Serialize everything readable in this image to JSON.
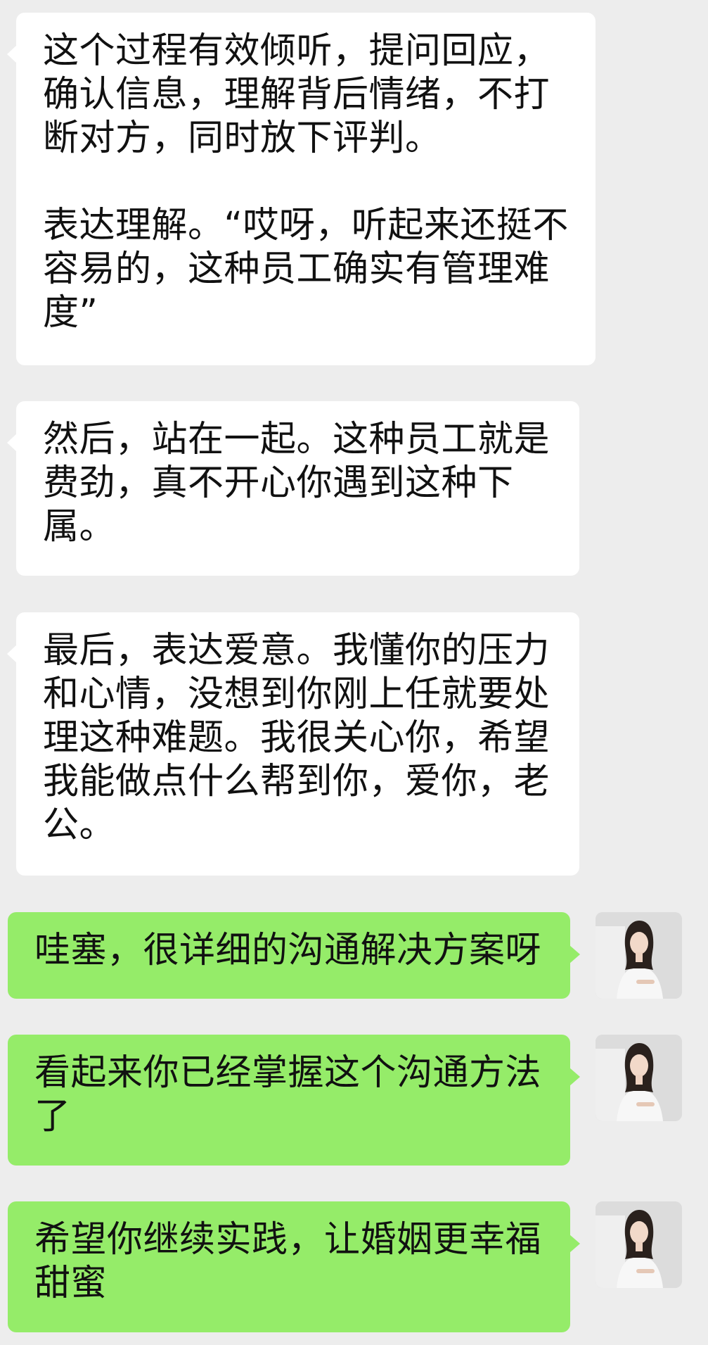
{
  "conversation": {
    "incoming": [
      {
        "text": "这个过程有效倾听，提问回应，\n确认信息，理解背后情绪，不打\n断对方，同时放下评判。\n\n表达理解。“哎呀，听起来还挺不\n容易的，这种员工确实有管理难\n度”"
      },
      {
        "text": "然后，站在一起。这种员工就是\n费劲，真不开心你遇到这种下\n属。"
      },
      {
        "text": "最后，表达爱意。我懂你的压力\n和心情，没想到你刚上任就要处\n理这种难题。我很关心你，希望\n我能做点什么帮到你，爱你，老\n公。"
      }
    ],
    "outgoing": [
      {
        "text": "哇塞，很详细的沟通解决方案呀"
      },
      {
        "text": "看起来你已经掌握这个沟通方法\n了"
      },
      {
        "text": "希望你继续实践，让婚姻更幸福\n甜蜜"
      }
    ]
  },
  "colors": {
    "background": "#ededed",
    "incoming_bubble": "#ffffff",
    "outgoing_bubble": "#95ec69"
  },
  "icons": {
    "avatar": "user-avatar"
  }
}
